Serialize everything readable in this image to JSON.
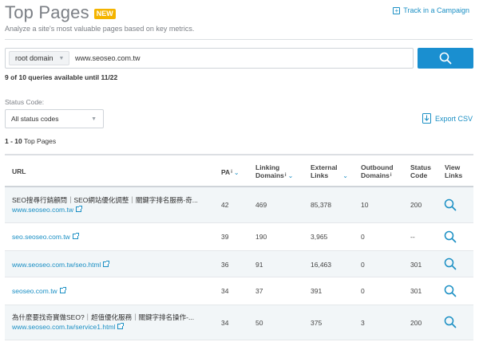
{
  "header": {
    "title": "Top Pages",
    "badge": "NEW",
    "subtitle": "Analyze a site's most valuable pages based on key metrics.",
    "track_label": "Track in a Campaign"
  },
  "search": {
    "scope": "root domain",
    "value": "www.seoseo.com.tw",
    "button_icon": "search-icon"
  },
  "queries_text": "9 of 10 queries available until 11/22",
  "filter": {
    "label": "Status Code:",
    "selected": "All status codes"
  },
  "export_label": "Export CSV",
  "results": {
    "range": "1 - 10",
    "label": "Top Pages"
  },
  "table": {
    "columns": {
      "url": "URL",
      "pa": "PA",
      "linking_1": "Linking",
      "linking_2": "Domains",
      "external_1": "External",
      "external_2": "Links",
      "outbound_1": "Outbound",
      "outbound_2": "Domains",
      "status_1": "Status",
      "status_2": "Code",
      "view_1": "View",
      "view_2": "Links"
    },
    "rows": [
      {
        "title": "SEO搜尋行銷顧問｜SEO網站優化調整｜關鍵字排名服務-奇...",
        "url": "www.seoseo.com.tw",
        "pa": "42",
        "linking": "469",
        "external": "85,378",
        "outbound": "10",
        "status": "200"
      },
      {
        "title": "",
        "url": "seo.seoseo.com.tw",
        "pa": "39",
        "linking": "190",
        "external": "3,965",
        "outbound": "0",
        "status": "--"
      },
      {
        "title": "",
        "url": "www.seoseo.com.tw/seo.html",
        "pa": "36",
        "linking": "91",
        "external": "16,463",
        "outbound": "0",
        "status": "301"
      },
      {
        "title": "",
        "url": "seoseo.com.tw",
        "pa": "34",
        "linking": "37",
        "external": "391",
        "outbound": "0",
        "status": "301"
      },
      {
        "title": "為什麼要找奇寶做SEO?｜超值優化服務｜關鍵字排名操作-...",
        "url": "www.seoseo.com.tw/service1.html",
        "pa": "34",
        "linking": "50",
        "external": "375",
        "outbound": "3",
        "status": "200"
      }
    ]
  },
  "colors": {
    "accent": "#1a8fc4",
    "button": "#1a8fd0",
    "badge": "#f4b400",
    "row_alt": "#f2f6f8"
  }
}
